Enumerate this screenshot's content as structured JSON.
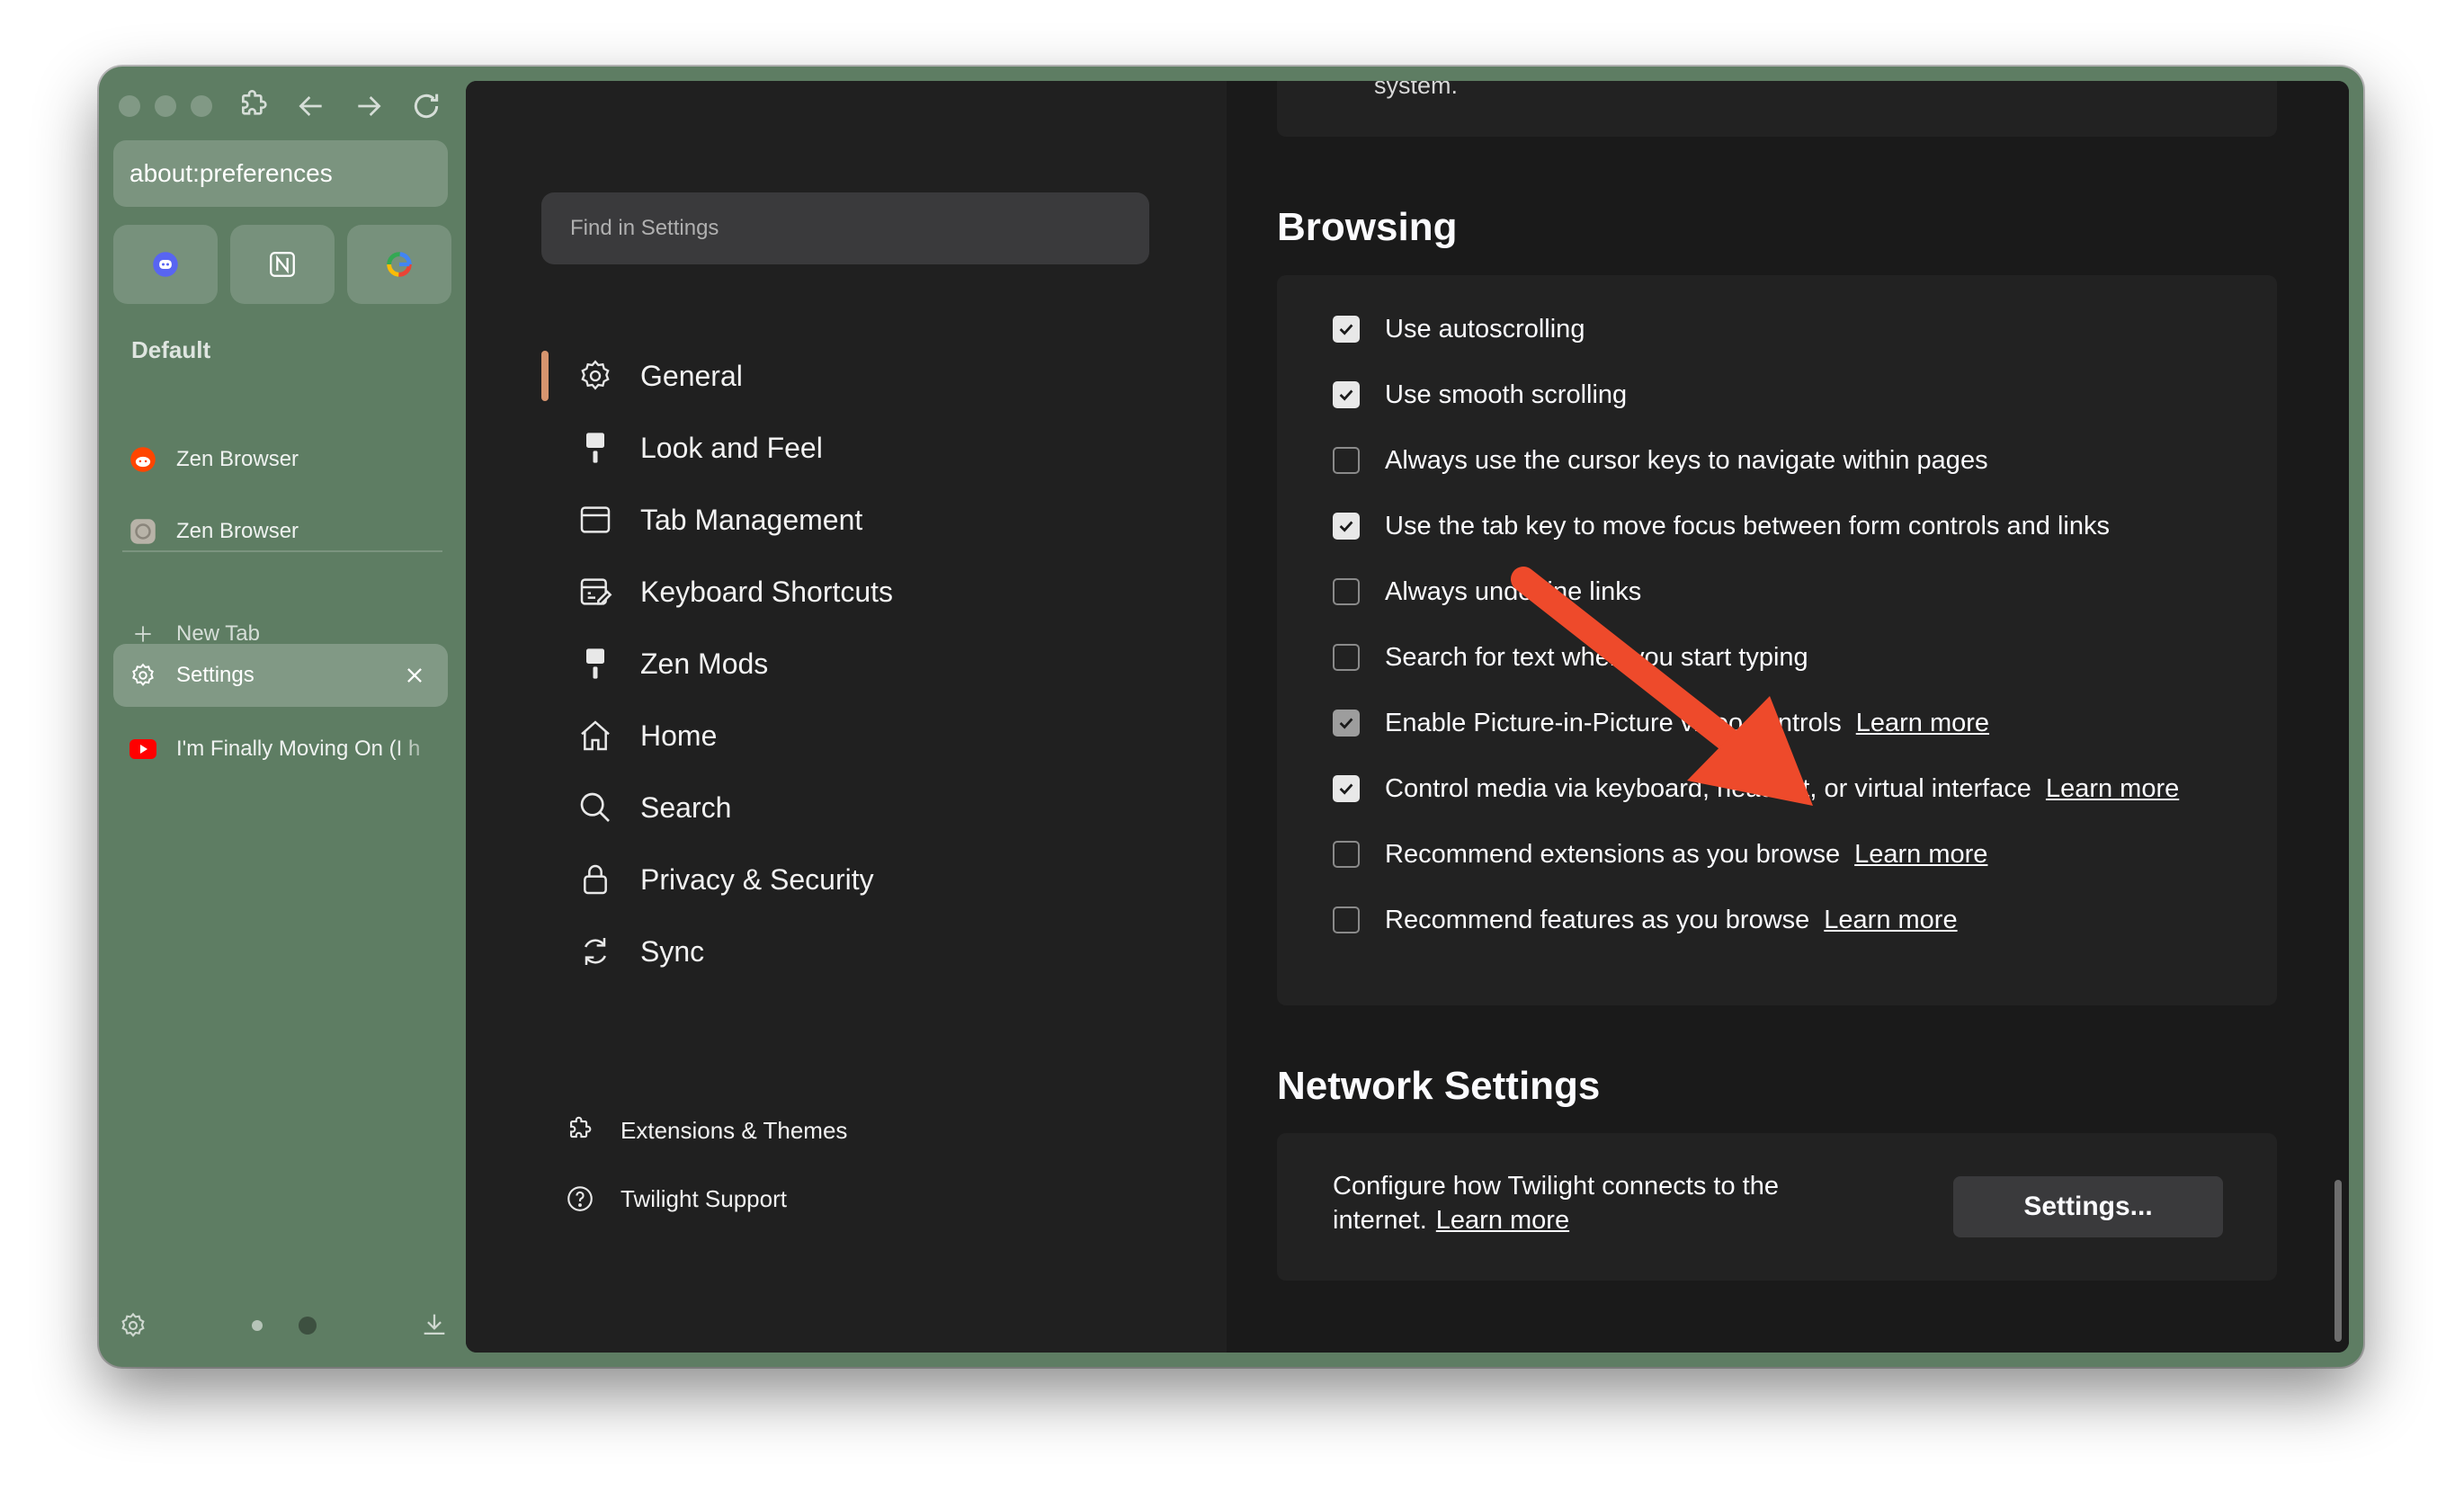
{
  "sidebar": {
    "url": "about:preferences",
    "workspace": "Default",
    "tabs": [
      {
        "label": "Zen Browser"
      },
      {
        "label": "Zen Browser"
      }
    ],
    "new_tab": "New Tab",
    "active_tab": "Settings",
    "youtube_tab": "I'm Finally Moving On (I h"
  },
  "nav": {
    "search_placeholder": "Find in Settings",
    "items": [
      {
        "label": "General",
        "icon": "gear-icon"
      },
      {
        "label": "Look and Feel",
        "icon": "brush-icon"
      },
      {
        "label": "Tab Management",
        "icon": "tab-window-icon"
      },
      {
        "label": "Keyboard Shortcuts",
        "icon": "keyboard-edit-icon"
      },
      {
        "label": "Zen Mods",
        "icon": "brush-icon"
      },
      {
        "label": "Home",
        "icon": "home-icon"
      },
      {
        "label": "Search",
        "icon": "magnifier-icon"
      },
      {
        "label": "Privacy & Security",
        "icon": "lock-icon"
      },
      {
        "label": "Sync",
        "icon": "sync-icon"
      }
    ],
    "footer": [
      {
        "label": "Extensions & Themes",
        "icon": "puzzle-icon"
      },
      {
        "label": "Twilight Support",
        "icon": "help-icon"
      }
    ]
  },
  "main": {
    "prev_tail": "system.",
    "browsing": {
      "title": "Browsing",
      "options": [
        {
          "label": "Use autoscrolling",
          "checked": true
        },
        {
          "label": "Use smooth scrolling",
          "checked": true
        },
        {
          "label": "Always use the cursor keys to navigate within pages",
          "checked": false
        },
        {
          "label": "Use the tab key to move focus between form controls and links",
          "checked": true
        },
        {
          "label": "Always underline links",
          "checked": false
        },
        {
          "label": "Search for text when you start typing",
          "checked": false
        },
        {
          "label": "Enable Picture-in-Picture video controls",
          "checked": true,
          "link": "Learn more"
        },
        {
          "label": "Control media via keyboard, headset, or virtual interface",
          "checked": true,
          "link": "Learn more"
        },
        {
          "label": "Recommend extensions as you browse",
          "checked": false,
          "link": "Learn more"
        },
        {
          "label": "Recommend features as you browse",
          "checked": false,
          "link": "Learn more"
        }
      ]
    },
    "network": {
      "title": "Network Settings",
      "desc_line1": "Configure how Twilight connects to the",
      "desc_line2": "internet.",
      "link": "Learn more",
      "button": "Settings..."
    }
  },
  "colors": {
    "sidebar_bg": "#5e7d63",
    "accent": "#d6956f",
    "arrow": "#ee4a2b"
  }
}
